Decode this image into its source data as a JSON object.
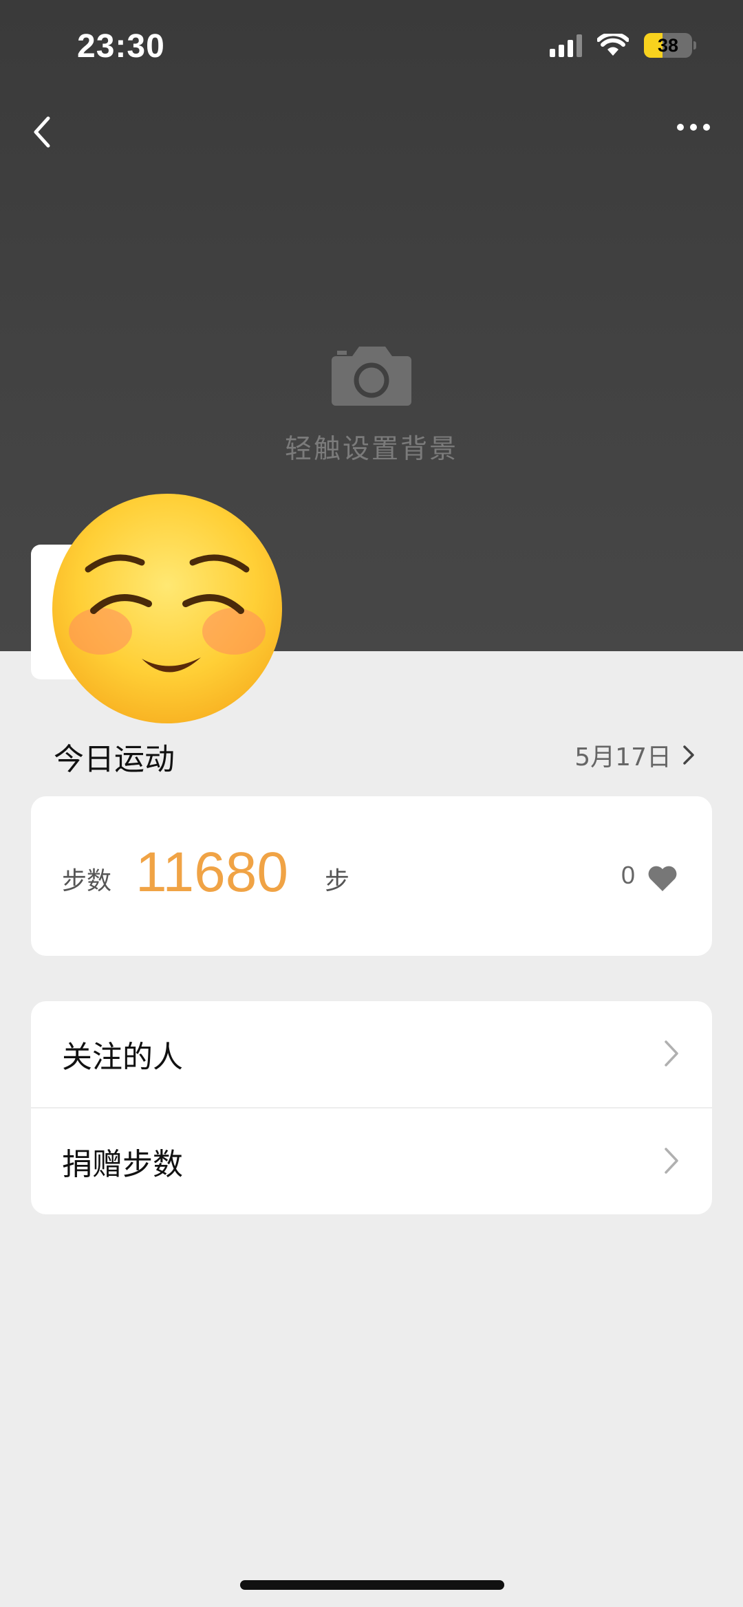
{
  "status_bar": {
    "time": "23:30",
    "battery_level": "38",
    "icons": [
      "cellular-signal-icon",
      "wifi-icon",
      "battery-icon"
    ]
  },
  "header": {
    "icons": [
      "back-arrow-icon",
      "more-options-icon"
    ],
    "background_prompt": "轻触设置背景",
    "camera_icon": "camera-icon"
  },
  "today": {
    "title": "今日运动",
    "date": "5月17日"
  },
  "steps": {
    "label": "步数",
    "value": "11680",
    "unit": "步",
    "likes": "0"
  },
  "menu": {
    "items": [
      {
        "label": "关注的人"
      },
      {
        "label": "捐赠步数"
      }
    ]
  },
  "colors": {
    "header_bg": "#404040",
    "page_bg": "#ededed",
    "steps_accent": "#f0a345"
  }
}
